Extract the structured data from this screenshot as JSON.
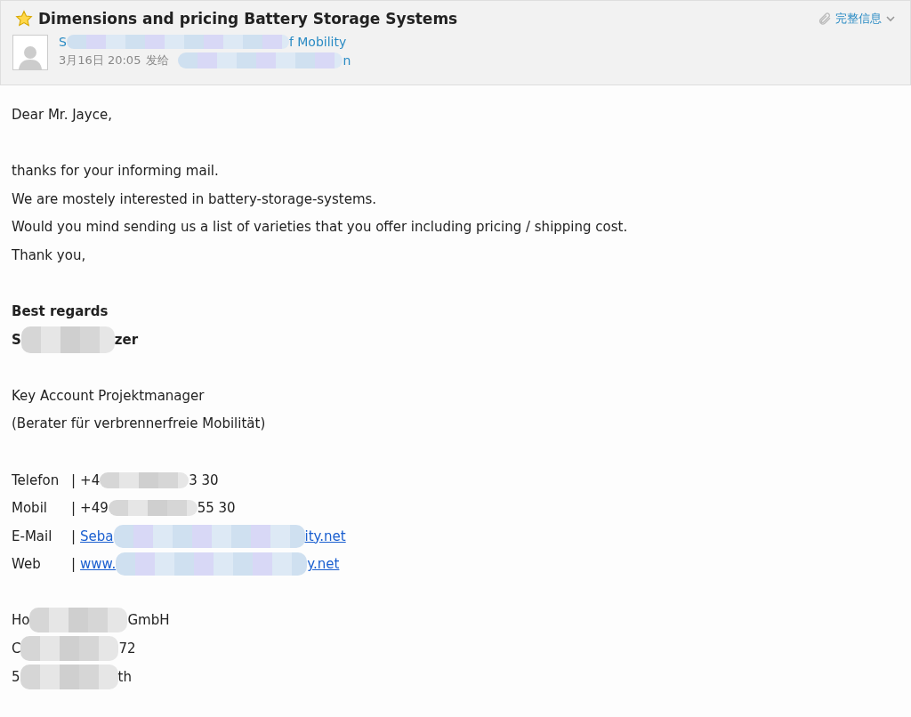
{
  "header": {
    "title": "Dimensions and pricing Battery Storage Systems",
    "starred": true,
    "sender": {
      "before": "S",
      "after": "f Mobility"
    },
    "time": "3月16日 20:05",
    "to_label": "发给",
    "recipient": {
      "after": "n"
    },
    "details": "完整信息"
  },
  "body": [
    {
      "kind": "text",
      "text": "Dear Mr. Jayce,"
    },
    {
      "kind": "blank"
    },
    {
      "kind": "text",
      "text": "thanks for your informing mail."
    },
    {
      "kind": "text",
      "text": "We are mostely interested in battery-storage-systems."
    },
    {
      "kind": "text",
      "text": "Would you mind sending us a list of varieties that you offer including pricing / shipping cost."
    },
    {
      "kind": "text",
      "text": "Thank you,"
    },
    {
      "kind": "blank"
    },
    {
      "kind": "bold",
      "text": "Best regards"
    },
    {
      "kind": "redacted",
      "bold": true,
      "before": "S",
      "after": "zer"
    },
    {
      "kind": "blank"
    },
    {
      "kind": "text",
      "text": "Key Account Projektmanager"
    },
    {
      "kind": "text",
      "text": "(Berater für verbrennerfreie Mobilität)"
    },
    {
      "kind": "blank"
    },
    {
      "kind": "contact",
      "label": "Telefon",
      "separator": "|",
      "link": false,
      "before": "+4",
      "after": "3 30"
    },
    {
      "kind": "contact",
      "label": "Mobil",
      "separator": "|",
      "link": false,
      "before": "+49",
      "after": "55 30"
    },
    {
      "kind": "contact",
      "label": "E-Mail",
      "separator": "|",
      "link": true,
      "before": "Seba",
      "after": "ity.net"
    },
    {
      "kind": "contact",
      "label": "Web",
      "separator": "|",
      "link": true,
      "before": "www.",
      "after": "y.net"
    },
    {
      "kind": "blank"
    },
    {
      "kind": "redacted",
      "bold": false,
      "before": "Ho",
      "after": "GmbH"
    },
    {
      "kind": "redacted",
      "bold": false,
      "before": "C",
      "after": "72"
    },
    {
      "kind": "redacted",
      "bold": false,
      "before": "5",
      "after": "th"
    }
  ]
}
